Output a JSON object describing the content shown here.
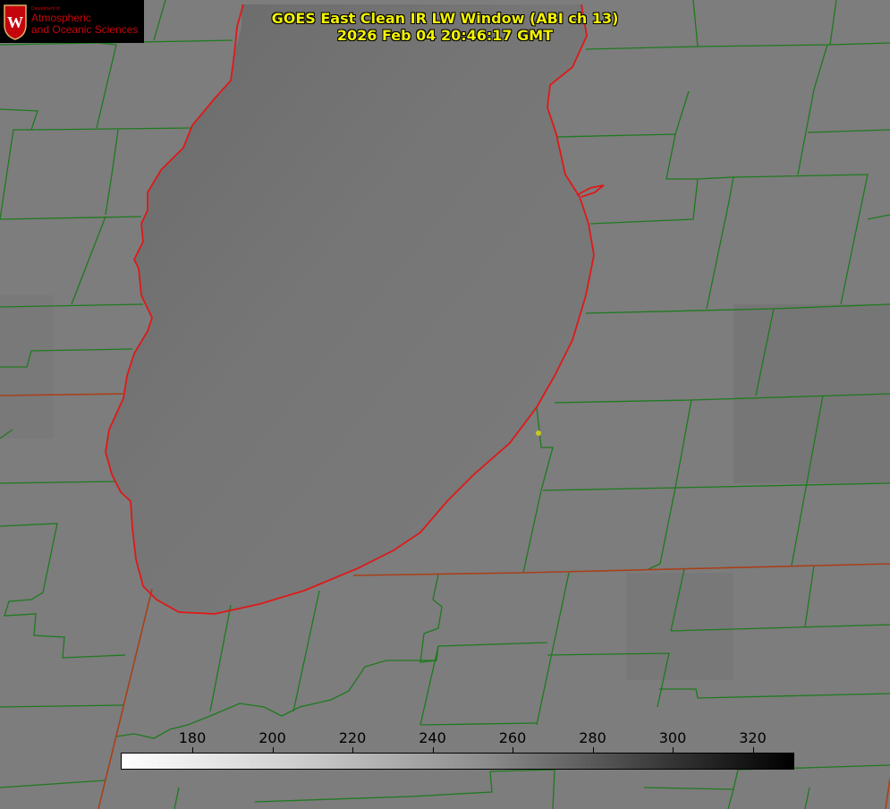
{
  "title": {
    "line1": "GOES East Clean IR LW Window (ABI ch 13)",
    "line2": "2026 Feb 04 20:46:17 GMT"
  },
  "logo": {
    "line_small": "Department of",
    "line1": "Atmospheric",
    "line2": "and Oceanic Sciences",
    "icon": "uw-crest-icon"
  },
  "colorbar": {
    "ticks": [
      "180",
      "200",
      "220",
      "240",
      "260",
      "280",
      "300",
      "320"
    ],
    "colors": {
      "low": "#ffffff",
      "high": "#000000"
    }
  },
  "colors": {
    "county_lines": "#1e7a1e",
    "state_lines": "#a8401a",
    "coastline": "#e01818",
    "title": "#f2f200",
    "marker": "#c8c81e",
    "background": "#7c7c7c"
  }
}
